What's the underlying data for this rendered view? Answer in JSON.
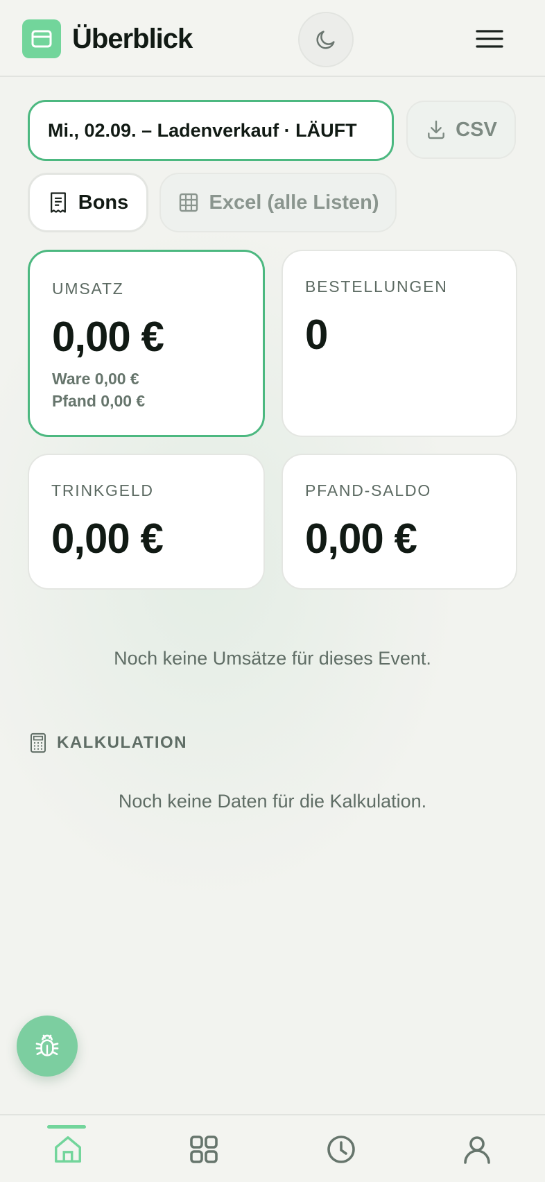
{
  "header": {
    "title": "Überblick",
    "icons": {
      "logo": "card-icon",
      "theme": "moon-icon",
      "menu": "hamburger-menu-icon"
    }
  },
  "event_selector": {
    "value": "Mi., 02.09. – Ladenverkauf · LÄUFT"
  },
  "actions": {
    "csv_label": "CSV",
    "bons_label": "Bons",
    "excel_label": "Excel (alle Listen)"
  },
  "stats": {
    "umsatz": {
      "label": "UMSATZ",
      "value": "0,00 €",
      "ware": "Ware 0,00 €",
      "pfand": "Pfand 0,00 €"
    },
    "bestellungen": {
      "label": "BESTELLUNGEN",
      "value": "0"
    },
    "trinkgeld": {
      "label": "TRINKGELD",
      "value": "0,00 €"
    },
    "pfand_saldo": {
      "label": "PFAND-SALDO",
      "value": "0,00 €"
    }
  },
  "empty_sales": "Noch keine Umsätze für dieses Event.",
  "kalkulation": {
    "heading": "KALKULATION",
    "empty": "Noch keine Daten für die Kalkulation."
  },
  "bottom_nav": {
    "items": [
      "home-icon",
      "grid-icon",
      "clock-icon",
      "user-icon"
    ],
    "active": "home-icon"
  },
  "colors": {
    "accent": "#4cb880",
    "accent_light": "#72d59b",
    "background": "#f2f3ef",
    "text": "#111a14",
    "muted": "#5f6d65"
  }
}
